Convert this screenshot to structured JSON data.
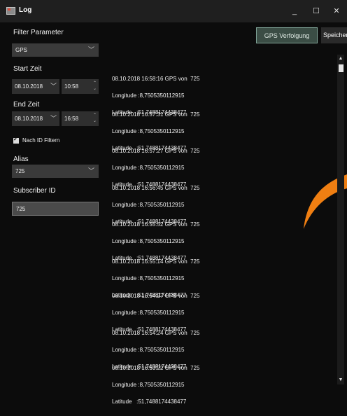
{
  "window": {
    "title": "Log",
    "minimize": "_",
    "maximize": "☐",
    "close": "✕"
  },
  "filter": {
    "parameter_label": "Filter Parameter",
    "parameter_value": "GPS",
    "start_label": "Start Zeit",
    "start_date": "08.10.2018",
    "start_time": "10:58",
    "end_label": "End Zeit",
    "end_date": "08.10.2018",
    "end_time": "16:58",
    "id_filter_label": "Nach ID Filtern",
    "id_filter_checked": true,
    "alias_label": "Alias",
    "alias_value": "725",
    "subscriber_label": "Subscriber ID",
    "subscriber_value": "725"
  },
  "toolbar": {
    "gps_tracking_label": "GPS Verfolgung",
    "save_label": "Speichern"
  },
  "log_entries": [
    {
      "header": "08.10.2018 16:58:16 GPS von  725",
      "longitude": "Longitude :8,7505350112915",
      "latitude": "Latitude   :51,7488174438477"
    },
    {
      "header": "08.10.2018 16:57:31 GPS von  725",
      "longitude": "Longitude :8,7505350112915",
      "latitude": "Latitude   :51,7488174438477"
    },
    {
      "header": "08.10.2018 16:57:27 GPS von  725",
      "longitude": "Longitude :8,7505350112915",
      "latitude": "Latitude   :51,7488174438477"
    },
    {
      "header": "08.10.2018 16:56:45 GPS von  725",
      "longitude": "Longitude :8,7505350112915",
      "latitude": "Latitude   :51,7488174438477"
    },
    {
      "header": "08.10.2018 16:55:52 GPS von  725",
      "longitude": "Longitude :8,7505350112915",
      "latitude": "Latitude   :51,7488174438477"
    },
    {
      "header": "08.10.2018 16:55:14 GPS von  725",
      "longitude": "Longitude :8,7505350112915",
      "latitude": "Latitude   :51,7488174438477"
    },
    {
      "header": "08.10.2018 16:54:27 GPS von  725",
      "longitude": "Longitude :8,7505350112915",
      "latitude": "Latitude   :51,7488174438477"
    },
    {
      "header": "08.10.2018 16:54:24 GPS von  725",
      "longitude": "Longitude :8,7505350112915",
      "latitude": "Latitude   :51,7488174438477"
    },
    {
      "header": "08.10.2018 16:53:22 GPS von  725",
      "longitude": "Longitude :8,7505350112915",
      "latitude": "Latitude   :51,7488174438477"
    }
  ],
  "icons": {
    "app": "app-icon",
    "dropdown": "chevron-down-icon",
    "spinner": "spinner-arrows-icon",
    "scroll_up": "chevron-up-icon",
    "scroll_down": "chevron-down-icon"
  },
  "colors": {
    "background": "#0c0c0c",
    "titlebar": "#1f1f1f",
    "combo": "#3a3a3a",
    "gps_button": "#3b4d45",
    "gps_button_border": "#7fa296",
    "accent_orange": "#f07f12"
  }
}
